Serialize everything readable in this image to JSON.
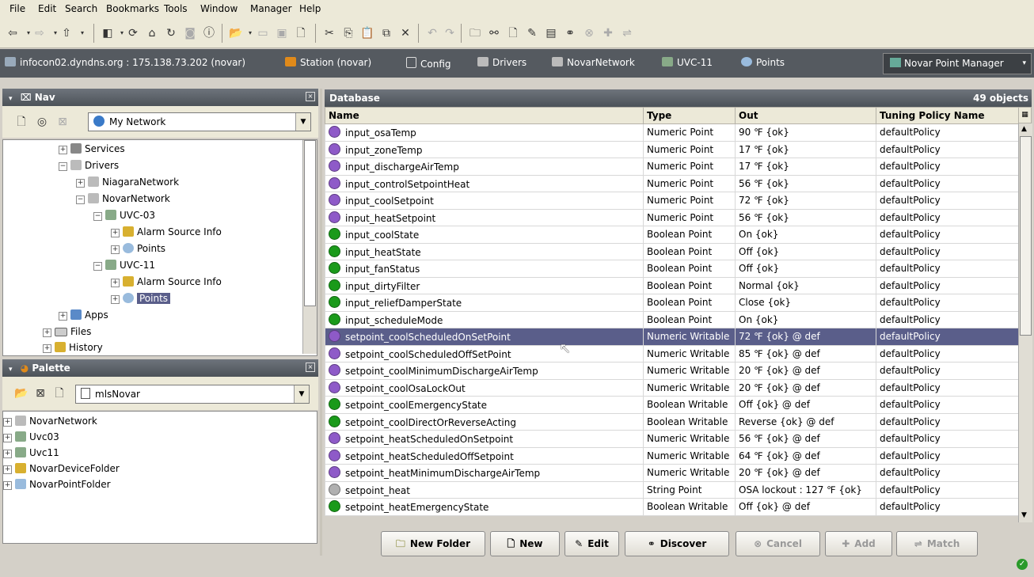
{
  "menu": [
    "File",
    "Edit",
    "Search",
    "Bookmarks",
    "Tools",
    "Window",
    "Manager",
    "Help"
  ],
  "locator": {
    "host": "infocon02.dyndns.org : 175.138.73.202 (novar)",
    "station": "Station (novar)",
    "config": "Config",
    "drivers": "Drivers",
    "network": "NovarNetwork",
    "device": "UVC-11",
    "points": "Points",
    "view": "Novar Point Manager"
  },
  "nav": {
    "title": "Nav",
    "root_select": "My Network",
    "tree": [
      "Services",
      "Drivers",
      "NiagaraNetwork",
      "NovarNetwork",
      "UVC-03",
      "Alarm Source Info",
      "Points",
      "UVC-11",
      "Alarm Source Info",
      "Points",
      "Apps",
      "Files",
      "History"
    ]
  },
  "palette": {
    "title": "Palette",
    "module_select": "mlsNovar",
    "items": [
      "NovarNetwork",
      "Uvc03",
      "Uvc11",
      "NovarDeviceFolder",
      "NovarPointFolder"
    ]
  },
  "database": {
    "title": "Database",
    "count": "49 objects",
    "columns": [
      "Name",
      "Type",
      "Out",
      "Tuning Policy Name"
    ],
    "rows": [
      {
        "name": "input_osaTemp",
        "type": "Numeric Point",
        "out": "90 ℉ {ok}",
        "policy": "defaultPolicy",
        "color": "#8e5ac8"
      },
      {
        "name": "input_zoneTemp",
        "type": "Numeric Point",
        "out": "17 ℉ {ok}",
        "policy": "defaultPolicy",
        "color": "#8e5ac8"
      },
      {
        "name": "input_dischargeAirTemp",
        "type": "Numeric Point",
        "out": "17 ℉ {ok}",
        "policy": "defaultPolicy",
        "color": "#8e5ac8"
      },
      {
        "name": "input_controlSetpointHeat",
        "type": "Numeric Point",
        "out": "56 ℉ {ok}",
        "policy": "defaultPolicy",
        "color": "#8e5ac8"
      },
      {
        "name": "input_coolSetpoint",
        "type": "Numeric Point",
        "out": "72 ℉ {ok}",
        "policy": "defaultPolicy",
        "color": "#8e5ac8"
      },
      {
        "name": "input_heatSetpoint",
        "type": "Numeric Point",
        "out": "56 ℉ {ok}",
        "policy": "defaultPolicy",
        "color": "#8e5ac8"
      },
      {
        "name": "input_coolState",
        "type": "Boolean Point",
        "out": "On {ok}",
        "policy": "defaultPolicy",
        "color": "#1a9a1a"
      },
      {
        "name": "input_heatState",
        "type": "Boolean Point",
        "out": "Off {ok}",
        "policy": "defaultPolicy",
        "color": "#1a9a1a"
      },
      {
        "name": "input_fanStatus",
        "type": "Boolean Point",
        "out": "Off {ok}",
        "policy": "defaultPolicy",
        "color": "#1a9a1a"
      },
      {
        "name": "input_dirtyFilter",
        "type": "Boolean Point",
        "out": "Normal {ok}",
        "policy": "defaultPolicy",
        "color": "#1a9a1a"
      },
      {
        "name": "input_reliefDamperState",
        "type": "Boolean Point",
        "out": "Close {ok}",
        "policy": "defaultPolicy",
        "color": "#1a9a1a"
      },
      {
        "name": "input_scheduleMode",
        "type": "Boolean Point",
        "out": "On {ok}",
        "policy": "defaultPolicy",
        "color": "#1a9a1a"
      },
      {
        "name": "setpoint_coolScheduledOnSetPoint",
        "type": "Numeric Writable",
        "out": "72 ℉ {ok} @ def",
        "policy": "defaultPolicy",
        "color": "#8e5ac8",
        "selected": true
      },
      {
        "name": "setpoint_coolScheduledOffSetPoint",
        "type": "Numeric Writable",
        "out": "85 ℉ {ok} @ def",
        "policy": "defaultPolicy",
        "color": "#8e5ac8"
      },
      {
        "name": "setpoint_coolMinimumDischargeAirTemp",
        "type": "Numeric Writable",
        "out": "20 ℉ {ok} @ def",
        "policy": "defaultPolicy",
        "color": "#8e5ac8"
      },
      {
        "name": "setpoint_coolOsaLockOut",
        "type": "Numeric Writable",
        "out": "20 ℉ {ok} @ def",
        "policy": "defaultPolicy",
        "color": "#8e5ac8"
      },
      {
        "name": "setpoint_coolEmergencyState",
        "type": "Boolean Writable",
        "out": "Off {ok} @ def",
        "policy": "defaultPolicy",
        "color": "#1a9a1a"
      },
      {
        "name": "setpoint_coolDirectOrReverseActing",
        "type": "Boolean Writable",
        "out": "Reverse {ok} @ def",
        "policy": "defaultPolicy",
        "color": "#1a9a1a"
      },
      {
        "name": "setpoint_heatScheduledOnSetpoint",
        "type": "Numeric Writable",
        "out": "56 ℉ {ok} @ def",
        "policy": "defaultPolicy",
        "color": "#8e5ac8"
      },
      {
        "name": "setpoint_heatScheduledOffSetpoint",
        "type": "Numeric Writable",
        "out": "64 ℉ {ok} @ def",
        "policy": "defaultPolicy",
        "color": "#8e5ac8"
      },
      {
        "name": "setpoint_heatMinimumDischargeAirTemp",
        "type": "Numeric Writable",
        "out": "20 ℉ {ok} @ def",
        "policy": "defaultPolicy",
        "color": "#8e5ac8"
      },
      {
        "name": "setpoint_heat",
        "type": "String Point",
        "out": "OSA lockout : 127 ℉ {ok}",
        "policy": "defaultPolicy",
        "color": "#b0b0b0"
      },
      {
        "name": "setpoint_heatEmergencyState",
        "type": "Boolean Writable",
        "out": "Off {ok} @ def",
        "policy": "defaultPolicy",
        "color": "#1a9a1a"
      }
    ]
  },
  "buttons": {
    "new_folder": "New Folder",
    "new": "New",
    "edit": "Edit",
    "discover": "Discover",
    "cancel": "Cancel",
    "add": "Add",
    "match": "Match"
  }
}
